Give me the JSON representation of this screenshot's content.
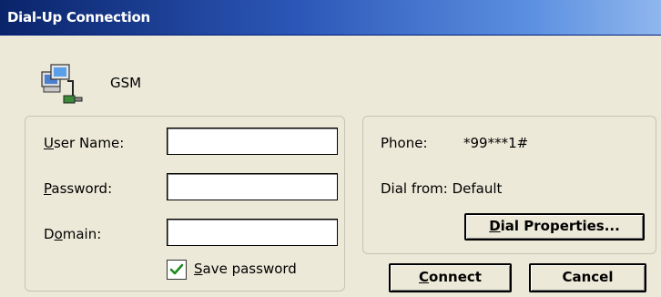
{
  "window": {
    "title": "Dial-Up Connection"
  },
  "connection": {
    "name": "GSM",
    "icon": "network-computers-icon"
  },
  "credentials": {
    "user_name": {
      "pre": "",
      "key": "U",
      "post": "ser Name:",
      "value": ""
    },
    "password": {
      "pre": "",
      "key": "P",
      "post": "assword:",
      "value": ""
    },
    "domain": {
      "pre": "D",
      "key": "o",
      "post": "main:",
      "value": ""
    },
    "save_password": {
      "pre": "",
      "key": "S",
      "post": "ave password",
      "checked": true
    }
  },
  "dial_info": {
    "phone_label": "Phone:",
    "phone_value": "*99***1#",
    "dial_from": "Dial from: Default"
  },
  "buttons": {
    "dial_properties": {
      "pre": "",
      "key": "D",
      "post": "ial Properties..."
    },
    "connect": {
      "pre": "",
      "key": "C",
      "post": "onnect"
    },
    "cancel": "Cancel"
  }
}
